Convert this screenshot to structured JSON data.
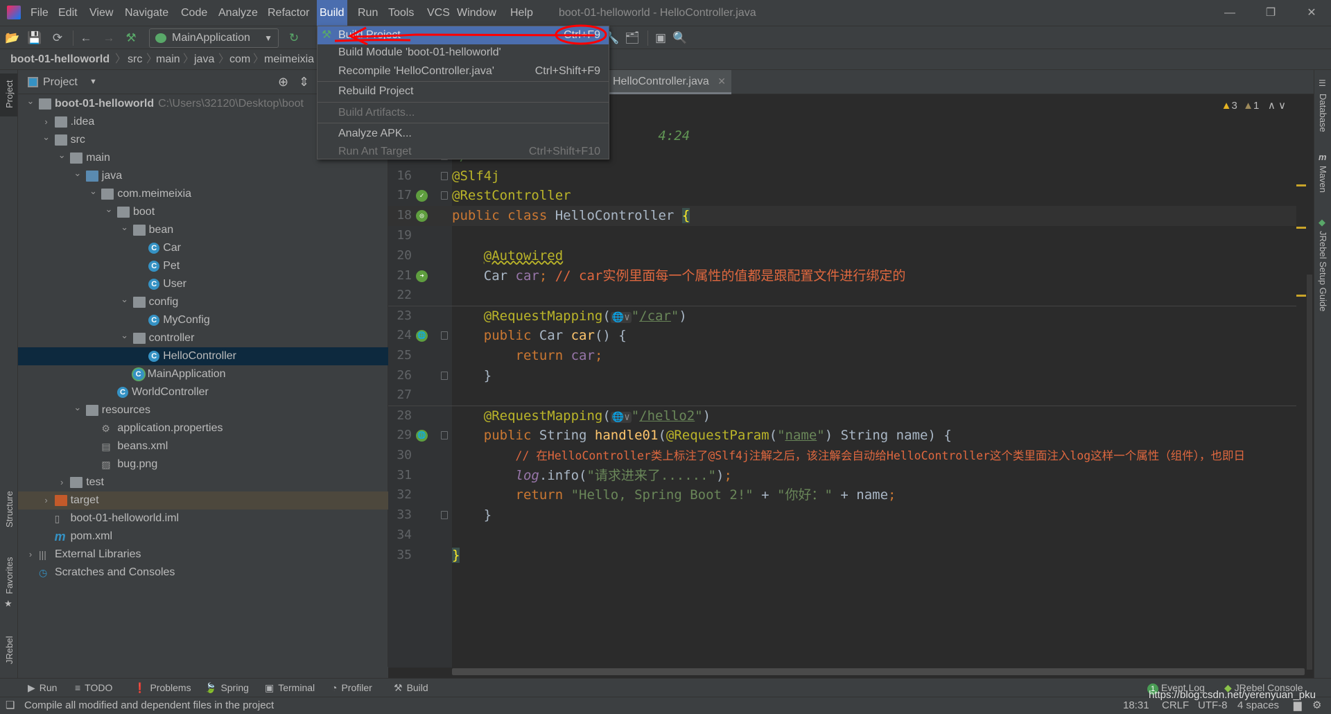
{
  "window": {
    "title": "boot-01-helloworld - HelloController.java",
    "controls": [
      "minimize",
      "restore",
      "close"
    ]
  },
  "menubar": [
    "File",
    "Edit",
    "View",
    "Navigate",
    "Code",
    "Analyze",
    "Refactor",
    "Build",
    "Run",
    "Tools",
    "VCS",
    "Window",
    "Help"
  ],
  "toolbar": {
    "run_config": "MainApplication"
  },
  "breadcrumb": [
    "boot-01-helloworld",
    "src",
    "main",
    "java",
    "com",
    "meimeixia"
  ],
  "left_stripe": [
    "Project",
    "Structure",
    "Favorites",
    "JRebel"
  ],
  "right_stripe": [
    "Database",
    "Maven",
    "JRebel Setup Guide"
  ],
  "project": {
    "title": "Project",
    "tree": [
      {
        "label": "boot-01-helloworld",
        "level": 0,
        "arrow": "open",
        "icon": "module",
        "bold": true,
        "hint": "C:\\Users\\32120\\Desktop\\boot"
      },
      {
        "label": ".idea",
        "level": 1,
        "arrow": "closed",
        "icon": "folder"
      },
      {
        "label": "src",
        "level": 1,
        "arrow": "open",
        "icon": "folder"
      },
      {
        "label": "main",
        "level": 2,
        "arrow": "open",
        "icon": "folder"
      },
      {
        "label": "java",
        "level": 3,
        "arrow": "open",
        "icon": "src"
      },
      {
        "label": "com.meimeixia",
        "level": 4,
        "arrow": "open",
        "icon": "pkg"
      },
      {
        "label": "boot",
        "level": 5,
        "arrow": "open",
        "icon": "pkg"
      },
      {
        "label": "bean",
        "level": 6,
        "arrow": "open",
        "icon": "pkg"
      },
      {
        "label": "Car",
        "level": 7,
        "icon": "class"
      },
      {
        "label": "Pet",
        "level": 7,
        "icon": "class"
      },
      {
        "label": "User",
        "level": 7,
        "icon": "class"
      },
      {
        "label": "config",
        "level": 6,
        "arrow": "open",
        "icon": "pkg"
      },
      {
        "label": "MyConfig",
        "level": 7,
        "icon": "class"
      },
      {
        "label": "controller",
        "level": 6,
        "arrow": "open",
        "icon": "pkg"
      },
      {
        "label": "HelloController",
        "level": 7,
        "icon": "class",
        "selected": true
      },
      {
        "label": "MainApplication",
        "level": 6,
        "icon": "spring-class"
      },
      {
        "label": "WorldController",
        "level": 5,
        "icon": "class"
      },
      {
        "label": "resources",
        "level": 3,
        "arrow": "open",
        "icon": "resources"
      },
      {
        "label": "application.properties",
        "level": 4,
        "icon": "properties"
      },
      {
        "label": "beans.xml",
        "level": 4,
        "icon": "xml"
      },
      {
        "label": "bug.png",
        "level": 4,
        "icon": "image"
      },
      {
        "label": "test",
        "level": 2,
        "arrow": "closed",
        "icon": "folder"
      },
      {
        "label": "target",
        "level": 1,
        "arrow": "closed",
        "icon": "excluded-folder",
        "highlight": true
      },
      {
        "label": "boot-01-helloworld.iml",
        "level": 1,
        "icon": "iml"
      },
      {
        "label": "pom.xml",
        "level": 1,
        "icon": "maven"
      },
      {
        "label": "External Libraries",
        "level": 0,
        "arrow": "closed",
        "icon": "libraries"
      },
      {
        "label": "Scratches and Consoles",
        "level": 0,
        "icon": "scratches"
      }
    ]
  },
  "editor": {
    "tab": "HelloController.java",
    "inspections": {
      "warnings": "3",
      "weak_warnings": "1"
    },
    "current_line": 18,
    "lines": [
      {
        "n": "",
        "tokens": [
          [
            "                          ",
            "t"
          ],
          [
            "4:24",
            "d"
          ]
        ]
      },
      {
        "n": "",
        "tokens": [
          [
            "*/",
            "d"
          ]
        ],
        "fold": true
      },
      {
        "n": "16",
        "tokens": [
          [
            "@Slf4j",
            "a"
          ]
        ],
        "fold": true
      },
      {
        "n": "17",
        "tokens": [
          [
            "@RestController",
            "a"
          ]
        ],
        "fold": true,
        "gutter": "spring-bean-icon"
      },
      {
        "n": "18",
        "tokens": [
          [
            "public",
            "k"
          ],
          [
            " ",
            "t"
          ],
          [
            "class",
            "k"
          ],
          [
            " HelloController ",
            "t"
          ],
          [
            "{",
            "b"
          ]
        ],
        "gutter": "spring-bean-web-icon"
      },
      {
        "n": "19",
        "tokens": []
      },
      {
        "n": "20",
        "tokens": [
          [
            "    ",
            "t"
          ],
          [
            "@Autowired",
            "w"
          ]
        ]
      },
      {
        "n": "21",
        "tokens": [
          [
            "    Car ",
            "t"
          ],
          [
            "car",
            "f"
          ],
          [
            ";",
            "k"
          ],
          [
            " // car实例里面每一个属性的值都是跟配置文件进行绑定的",
            "c"
          ]
        ],
        "gutter": "autowired-icon"
      },
      {
        "n": "22",
        "tokens": []
      },
      {
        "n": "23",
        "tokens": [
          [
            "    ",
            "t"
          ],
          [
            "@RequestMapping",
            "a"
          ],
          [
            "(",
            "t"
          ],
          [
            "🌐∨",
            "inlay"
          ],
          [
            "\"",
            "s"
          ],
          [
            "/car",
            "u"
          ],
          [
            "\"",
            "s"
          ],
          [
            ")",
            "t"
          ]
        ],
        "sep": true
      },
      {
        "n": "24",
        "tokens": [
          [
            "    ",
            "t"
          ],
          [
            "public",
            "k"
          ],
          [
            " Car ",
            "t"
          ],
          [
            "car",
            "m"
          ],
          [
            "() {",
            "t"
          ]
        ],
        "fold": true,
        "gutter": "web-endpoint-icon"
      },
      {
        "n": "25",
        "tokens": [
          [
            "        ",
            "t"
          ],
          [
            "return",
            "k"
          ],
          [
            " ",
            "t"
          ],
          [
            "car",
            "f"
          ],
          [
            ";",
            "k"
          ]
        ]
      },
      {
        "n": "26",
        "tokens": [
          [
            "    }",
            "t"
          ]
        ],
        "fold": true
      },
      {
        "n": "27",
        "tokens": []
      },
      {
        "n": "28",
        "tokens": [
          [
            "    ",
            "t"
          ],
          [
            "@RequestMapping",
            "a"
          ],
          [
            "(",
            "t"
          ],
          [
            "🌐∨",
            "inlay"
          ],
          [
            "\"",
            "s"
          ],
          [
            "/hello2",
            "u"
          ],
          [
            "\"",
            "s"
          ],
          [
            ")",
            "t"
          ]
        ],
        "sep": true
      },
      {
        "n": "29",
        "tokens": [
          [
            "    ",
            "t"
          ],
          [
            "public",
            "k"
          ],
          [
            " String ",
            "t"
          ],
          [
            "handle01",
            "m"
          ],
          [
            "(",
            "t"
          ],
          [
            "@RequestParam",
            "a"
          ],
          [
            "(",
            "t"
          ],
          [
            "\"",
            "s"
          ],
          [
            "name",
            "u"
          ],
          [
            "\"",
            "s"
          ],
          [
            ") String name) {",
            "t"
          ]
        ],
        "fold": true,
        "gutter": "web-endpoint-icon"
      },
      {
        "n": "30",
        "tokens": [
          [
            "        ",
            "t"
          ],
          [
            "// 在HelloController类上标注了@Slf4j注解之后，该注解会自动给HelloController这个类里面注入log这样一个属性（组件），也即日",
            "c"
          ]
        ]
      },
      {
        "n": "31",
        "tokens": [
          [
            "        ",
            "t"
          ],
          [
            "log",
            "lg"
          ],
          [
            ".info(",
            "t"
          ],
          [
            "\"请求进来了......\"",
            "s"
          ],
          [
            ")",
            "t"
          ],
          [
            ";",
            "k"
          ]
        ]
      },
      {
        "n": "32",
        "tokens": [
          [
            "        ",
            "t"
          ],
          [
            "return",
            "k"
          ],
          [
            " ",
            "t"
          ],
          [
            "\"Hello, Spring Boot 2!\"",
            "s"
          ],
          [
            " + ",
            "t"
          ],
          [
            "\"你好：\"",
            "s"
          ],
          [
            " + name",
            "t"
          ],
          [
            ";",
            "k"
          ]
        ]
      },
      {
        "n": "33",
        "tokens": [
          [
            "    }",
            "t"
          ]
        ],
        "fold": true
      },
      {
        "n": "34",
        "tokens": []
      },
      {
        "n": "35",
        "tokens": [
          [
            "}",
            "b"
          ]
        ]
      }
    ]
  },
  "build_menu": {
    "items": [
      {
        "label": "Build Project",
        "shortcut": "Ctrl+F9",
        "selected": true,
        "icon": "hammer-icon"
      },
      {
        "label": "Build Module 'boot-01-helloworld'",
        "shortcut": ""
      },
      {
        "label": "Recompile 'HelloController.java'",
        "shortcut": "Ctrl+Shift+F9"
      },
      {
        "separator": true
      },
      {
        "label": "Rebuild Project",
        "shortcut": ""
      },
      {
        "separator": true
      },
      {
        "label": "Build Artifacts...",
        "shortcut": "",
        "disabled": true
      },
      {
        "separator": true
      },
      {
        "label": "Analyze APK...",
        "shortcut": ""
      },
      {
        "label": "Run Ant Target",
        "shortcut": "Ctrl+Shift+F10",
        "disabled": true
      }
    ]
  },
  "bottom_tools": [
    {
      "label": "Run",
      "icon": "▶"
    },
    {
      "label": "TODO",
      "icon": "≡"
    },
    {
      "label": "Problems",
      "icon": "❗"
    },
    {
      "label": "Spring",
      "icon": "🍃"
    },
    {
      "label": "Terminal",
      "icon": "▣"
    },
    {
      "label": "Profiler",
      "icon": "◔"
    },
    {
      "label": "Build",
      "icon": "⚒"
    }
  ],
  "bottom_right": {
    "event_log": "Event Log",
    "event_log_count": "1",
    "jrebel": "JRebel Console"
  },
  "status": {
    "message": "Compile all modified and dependent files in the project",
    "position": "18:31",
    "line_sep": "CRLF",
    "encoding": "UTF-8",
    "indent": "4 spaces"
  },
  "watermark": "https://blog.csdn.net/yerenyuan_pku",
  "colors": {
    "accent": "#4b6eaf",
    "annotation_red": "#ff0000",
    "keyword": "#cc7832",
    "annotation": "#bbb529",
    "string": "#6a8759"
  }
}
